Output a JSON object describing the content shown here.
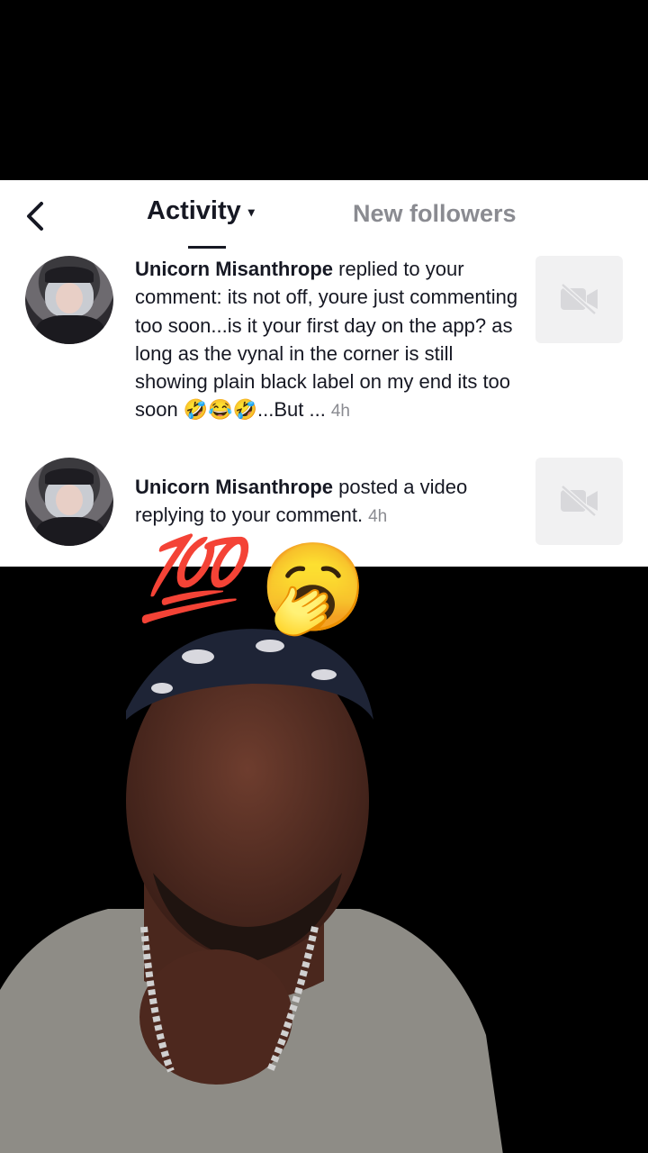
{
  "header": {
    "back_icon": "chevron-left-icon",
    "active_tab": "Activity",
    "active_tab_caret": "▾",
    "other_tab": "New followers"
  },
  "notifications": [
    {
      "username": "Unicorn Misanthrope",
      "message": " replied to your comment: its not off, youre just commenting too soon...is it your first day on the app? as long as the vynal in the corner is still showing plain black label on my end its too soon 🤣😂🤣...But ...",
      "time": "4h",
      "thumbnail_icon": "video-off-icon"
    },
    {
      "username": "Unicorn Misanthrope",
      "message": " posted a video replying to your comment.",
      "time": "4h",
      "thumbnail_icon": "video-off-icon"
    }
  ],
  "overlay": {
    "emoji_1": "💯",
    "emoji_2": "🥱"
  }
}
